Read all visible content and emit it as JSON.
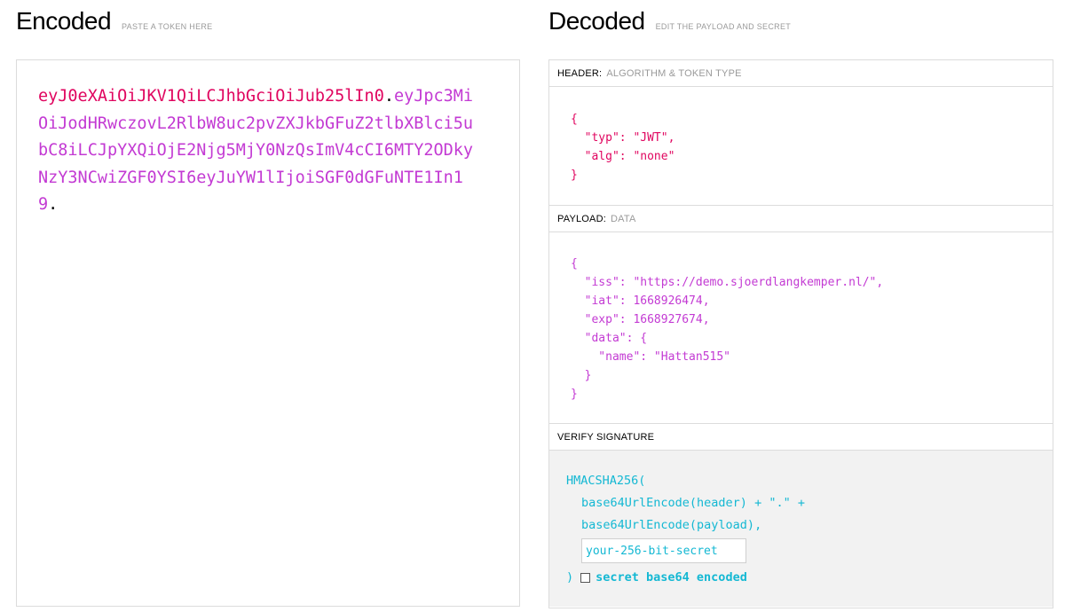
{
  "encoded": {
    "title": "Encoded",
    "subtitle": "PASTE A TOKEN HERE",
    "token_header": "eyJ0eXAiOiJKV1QiLCJhbGciOiJub25lIn0",
    "token_payload": "eyJpc3MiOiJodHRwczovL2RlbW8uc2pvZXJkbGFuZ2tlbXBlci5ubC8iLCJpYXQiOjE2Njg5MjY0NzQsImV4cCI6MTY2ODkyNzY3NCwiZGF0YSI6eyJuYW1lIjoiSGF0dGFuNTE1In19",
    "dot": "."
  },
  "decoded": {
    "title": "Decoded",
    "subtitle": "EDIT THE PAYLOAD AND SECRET",
    "header_label": "HEADER:",
    "header_sublabel": "ALGORITHM & TOKEN TYPE",
    "header_json": "{\n  \"typ\": \"JWT\",\n  \"alg\": \"none\"\n}",
    "payload_label": "PAYLOAD:",
    "payload_sublabel": "DATA",
    "payload_json": "{\n  \"iss\": \"https://demo.sjoerdlangkemper.nl/\",\n  \"iat\": 1668926474,\n  \"exp\": 1668927674,\n  \"data\": {\n    \"name\": \"Hattan515\"\n  }\n}",
    "verify_label": "VERIFY SIGNATURE",
    "verify": {
      "fn_open": "HMACSHA256(",
      "line_header": "base64UrlEncode(header) + \".\" +",
      "line_payload": "base64UrlEncode(payload),",
      "secret_placeholder": "your-256-bit-secret",
      "close_paren": ")",
      "checkbox_label": "secret base64 encoded"
    }
  },
  "colors": {
    "header": "#e0055f",
    "payload": "#c33ad3",
    "signature": "#14b8d3"
  }
}
